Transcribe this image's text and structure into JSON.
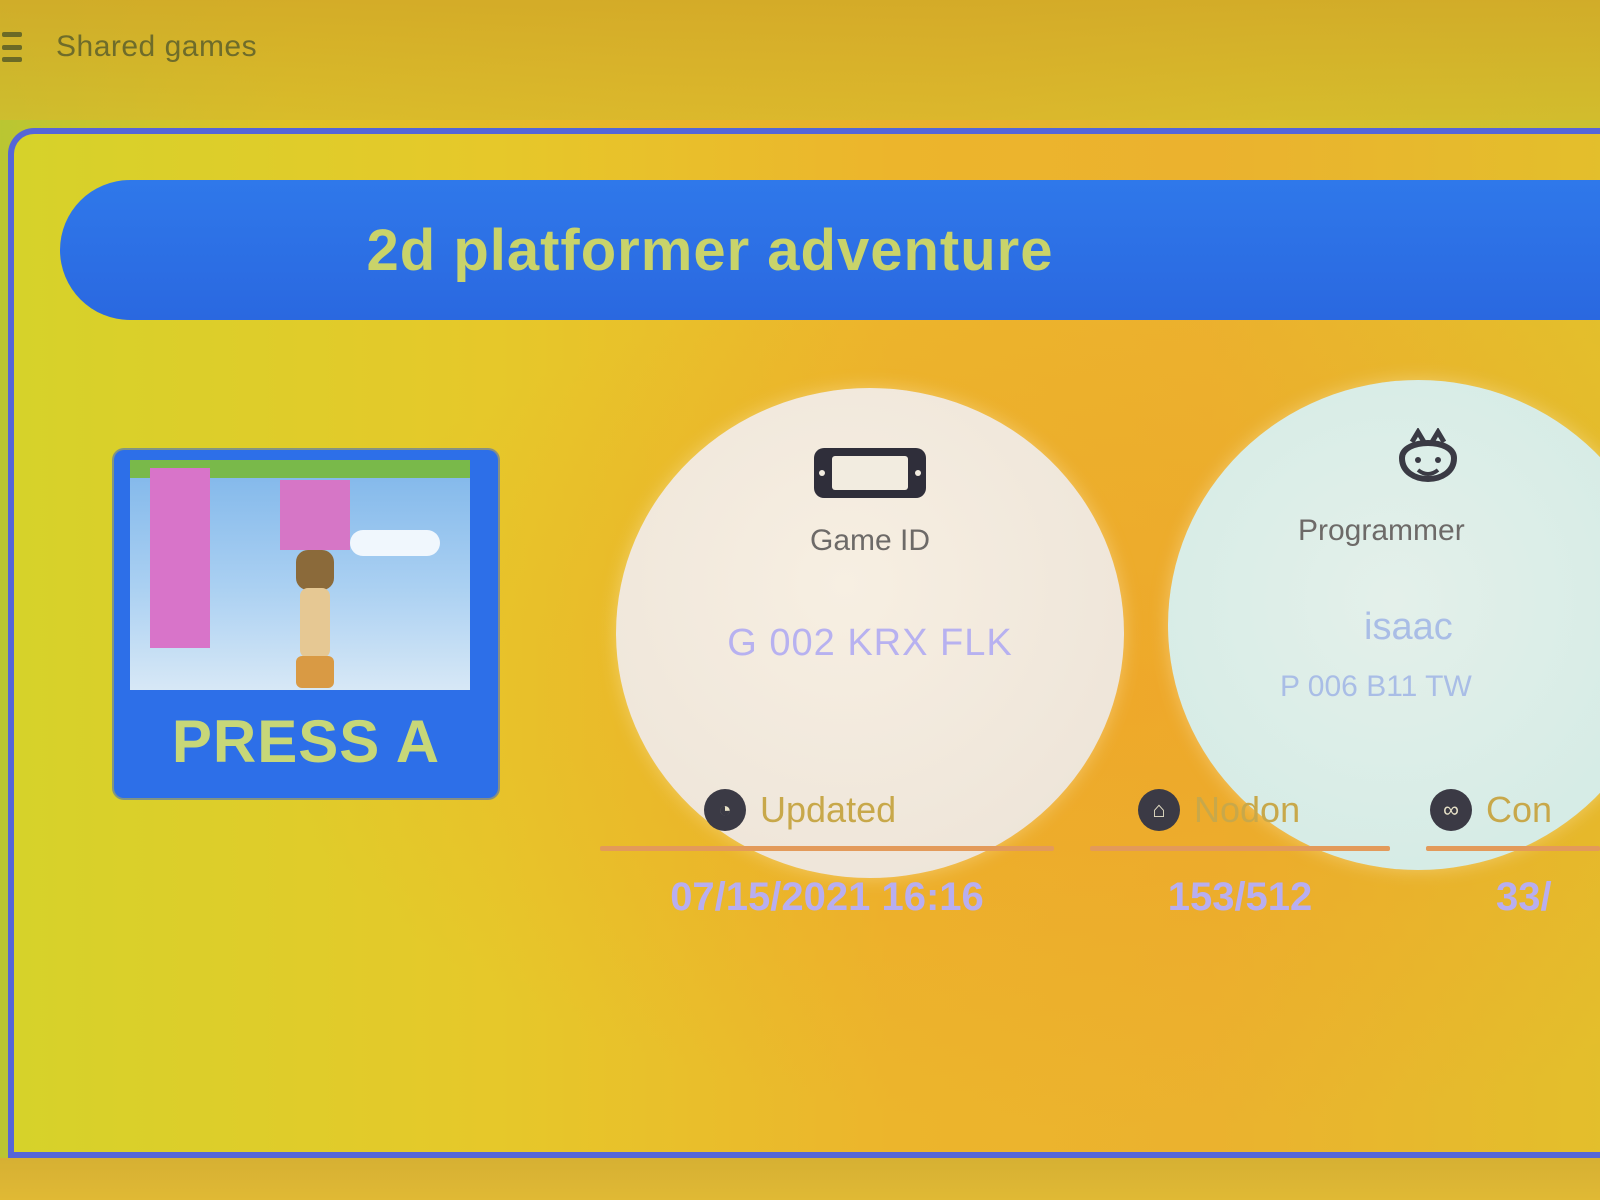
{
  "header": {
    "section_title": "Shared games"
  },
  "game": {
    "title": "2d platformer adventure",
    "thumbnail_label": "PRESS A",
    "game_id_label": "Game ID",
    "game_id_value": "G 002 KRX FLK",
    "programmer_label": "Programmer",
    "programmer_name": "isaac",
    "programmer_id": "P 006 B11 TW"
  },
  "stats": {
    "updated_label": "Updated",
    "updated_value": "07/15/2021 16:16",
    "nodon_label": "Nodon",
    "nodon_value": "153/512",
    "connections_label": "Con",
    "connections_value": "33/"
  },
  "colors": {
    "banner_blue": "#2f78ea",
    "title_text": "#c9d36a",
    "value_text": "#b7b1f0",
    "underline": "#e39a5a"
  },
  "icons": {
    "menu": "menu-icon",
    "game_id": "handheld-console-icon",
    "programmer": "face-icon",
    "updated": "clock-icon",
    "nodon": "house-icon",
    "connections": "link-icon"
  }
}
